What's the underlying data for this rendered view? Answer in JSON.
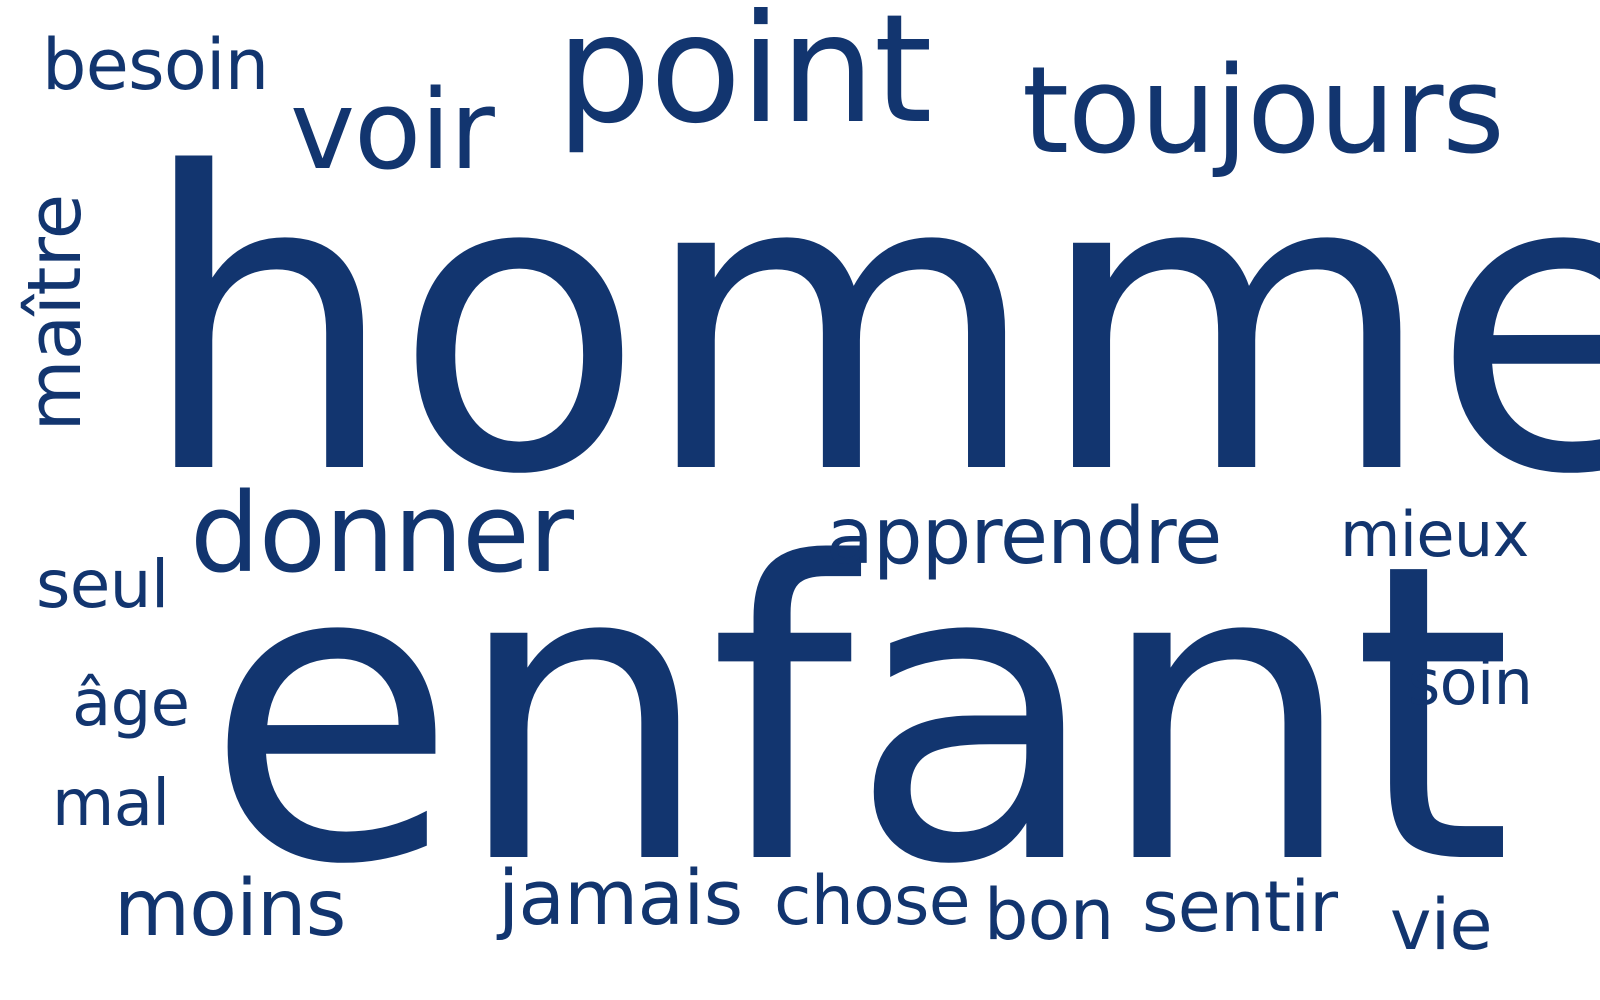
{
  "word_cloud": {
    "color": "#12356F",
    "words": [
      {
        "text": "homme",
        "id": "homme"
      },
      {
        "text": "enfant",
        "id": "enfant"
      },
      {
        "text": "point",
        "id": "point"
      },
      {
        "text": "toujours",
        "id": "toujours"
      },
      {
        "text": "voir",
        "id": "voir"
      },
      {
        "text": "donner",
        "id": "donner"
      },
      {
        "text": "apprendre",
        "id": "apprendre"
      },
      {
        "text": "besoin",
        "id": "besoin"
      },
      {
        "text": "maître",
        "id": "maitre"
      },
      {
        "text": "seul",
        "id": "seul"
      },
      {
        "text": "âge",
        "id": "age"
      },
      {
        "text": "mal",
        "id": "mal"
      },
      {
        "text": "mieux",
        "id": "mieux"
      },
      {
        "text": "soin",
        "id": "soin"
      },
      {
        "text": "moins",
        "id": "moins"
      },
      {
        "text": "jamais",
        "id": "jamais"
      },
      {
        "text": "chose",
        "id": "chose"
      },
      {
        "text": "bon",
        "id": "bon"
      },
      {
        "text": "sentir",
        "id": "sentir"
      },
      {
        "text": "vie",
        "id": "vie"
      }
    ]
  }
}
